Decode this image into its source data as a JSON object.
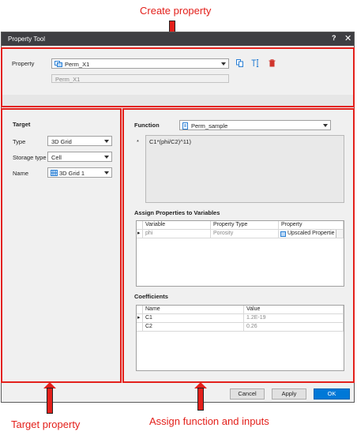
{
  "annotations": {
    "create": "Create property",
    "target": "Target property",
    "assign": "Assign function and inputs"
  },
  "window": {
    "title": "Property Tool",
    "help": "?",
    "close": "✕"
  },
  "property": {
    "label": "Property",
    "value": "Perm_X1",
    "name_field": "Perm_X1"
  },
  "target": {
    "heading": "Target",
    "type_label": "Type",
    "type_value": "3D Grid",
    "storage_label": "Storage type",
    "storage_value": "Cell",
    "name_label": "Name",
    "name_value": "3D Grid 1"
  },
  "function": {
    "label": "Function",
    "value": "Perm_sample",
    "asterisk": "*",
    "expression": "C1*(phi/C2)^11)"
  },
  "assign": {
    "heading": "Assign Properties to Variables",
    "columns": [
      "Variable",
      "Property Type",
      "Property"
    ],
    "rows": [
      {
        "variable": "phi",
        "type": "Porosity",
        "property": "Upscaled Propertie"
      }
    ]
  },
  "coefficients": {
    "heading": "Coefficients",
    "columns": [
      "Name",
      "Value"
    ],
    "rows": [
      {
        "name": "C1",
        "value": "1.2E-19"
      },
      {
        "name": "C2",
        "value": "0.26"
      }
    ]
  },
  "buttons": {
    "cancel": "Cancel",
    "apply": "Apply",
    "ok": "OK"
  },
  "colors": {
    "annotation": "#e3201b",
    "titlebar": "#3e3e42",
    "ok_button": "#0078d7"
  }
}
